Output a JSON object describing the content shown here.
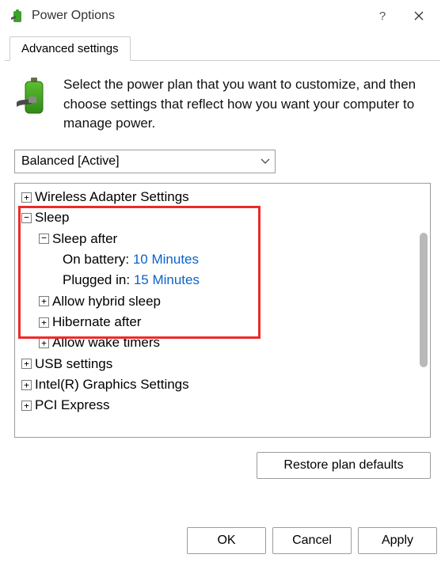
{
  "window": {
    "title": "Power Options"
  },
  "tab": {
    "label": "Advanced settings"
  },
  "intro": {
    "text": "Select the power plan that you want to customize, and then choose settings that reflect how you want your computer to manage power."
  },
  "plan": {
    "selected": "Balanced [Active]"
  },
  "tree": {
    "wireless": "Wireless Adapter Settings",
    "sleep": {
      "label": "Sleep",
      "after": {
        "label": "Sleep after",
        "battery_label": "On battery:",
        "battery_value": "10 Minutes",
        "plugged_label": "Plugged in:",
        "plugged_value": "15 Minutes"
      },
      "hybrid": "Allow hybrid sleep",
      "hibernate": "Hibernate after",
      "wake": "Allow wake timers"
    },
    "usb": "USB settings",
    "graphics": "Intel(R) Graphics Settings",
    "pci": "PCI Express"
  },
  "buttons": {
    "restore": "Restore plan defaults",
    "ok": "OK",
    "cancel": "Cancel",
    "apply": "Apply"
  }
}
